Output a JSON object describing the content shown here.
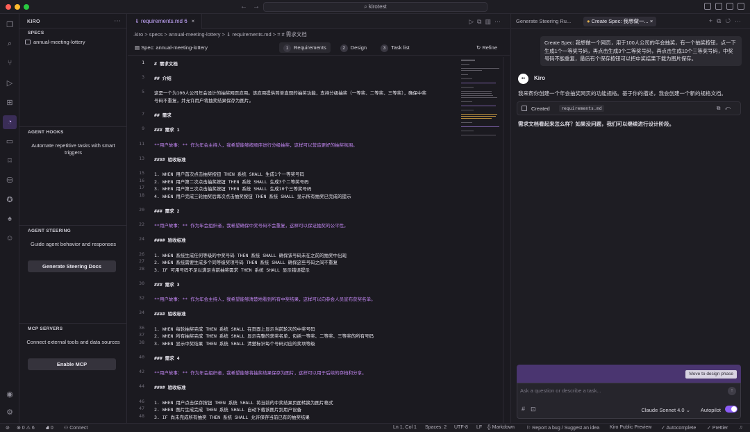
{
  "titlebar": {
    "search": "kirotest"
  },
  "sidebar": {
    "title": "KIRO",
    "specs_header": "SPECS",
    "spec_item": "annual-meeting-lottery",
    "hooks_header": "AGENT HOOKS",
    "hooks_text": "Automate repetitive tasks with smart triggers",
    "steering_header": "AGENT STEERING",
    "steering_text": "Guide agent behavior and responses",
    "steering_button": "Generate Steering Docs",
    "mcp_header": "MCP SERVERS",
    "mcp_text": "Connect external tools and data sources",
    "mcp_button": "Enable MCP"
  },
  "editor": {
    "tab_label": "requirements.md",
    "tab_badge": "6",
    "breadcrumb": ".kiro > specs > annual-meeting-lottery > ⇓ requirements.md > ⌗ # 需求文档",
    "spec_label": "Spec: annual-meeting-lottery",
    "steps": [
      {
        "n": "1",
        "label": "Requirements"
      },
      {
        "n": "2",
        "label": "Design"
      },
      {
        "n": "3",
        "label": "Task list"
      }
    ],
    "refine": "Refine",
    "lines": [
      {
        "n": "1",
        "t": "# 需求文档"
      },
      {
        "n": "",
        "t": ""
      },
      {
        "n": "3",
        "t": "## 介绍"
      },
      {
        "n": "",
        "t": ""
      },
      {
        "n": "5",
        "t": "这是一个为100人公司年会设计的抽奖网页应用。该应用提供简单直观的抽奖功能，支持分级抽奖（一等奖、二等奖、三等奖），确保中奖"
      },
      {
        "n": "",
        "t": "号码不重复，并允许用户将抽奖结果保存为图片。"
      },
      {
        "n": "",
        "t": ""
      },
      {
        "n": "7",
        "t": "## 需求"
      },
      {
        "n": "",
        "t": ""
      },
      {
        "n": "9",
        "t": "### 需求 1"
      },
      {
        "n": "",
        "t": ""
      },
      {
        "n": "11",
        "t": "**用户故事：** 作为年会主持人，我希望能够按顺序进行分级抽奖，这样可以营造更好的抽奖氛围。"
      },
      {
        "n": "",
        "t": ""
      },
      {
        "n": "13",
        "t": "#### 验收标准"
      },
      {
        "n": "",
        "t": ""
      },
      {
        "n": "15",
        "t": "1. WHEN 用户首次点击抽奖按钮 THEN 系统 SHALL 生成1个一等奖号码"
      },
      {
        "n": "16",
        "t": "2. WHEN 用户第二次点击抽奖按钮 THEN 系统 SHALL 生成3个二等奖号码"
      },
      {
        "n": "17",
        "t": "3. WHEN 用户第三次点击抽奖按钮 THEN 系统 SHALL 生成10个三等奖号码"
      },
      {
        "n": "18",
        "t": "4. WHEN 用户完成三轮抽奖后再次点击抽奖按钮 THEN 系统 SHALL 显示所有抽奖已完成的提示"
      },
      {
        "n": "",
        "t": ""
      },
      {
        "n": "20",
        "t": "### 需求 2"
      },
      {
        "n": "",
        "t": ""
      },
      {
        "n": "22",
        "t": "**用户故事：** 作为年会组织者，我希望确保中奖号码不会重复，这样可以保证抽奖的公平性。"
      },
      {
        "n": "",
        "t": ""
      },
      {
        "n": "24",
        "t": "#### 验收标准"
      },
      {
        "n": "",
        "t": ""
      },
      {
        "n": "26",
        "t": "1. WHEN 系统生成任何等级的中奖号码 THEN 系统 SHALL 确保该号码未在之前的抽奖中出现"
      },
      {
        "n": "27",
        "t": "2. WHEN 系统需要生成多个同等级奖项号码 THEN 系统 SHALL 确保这些号码之间不重复"
      },
      {
        "n": "28",
        "t": "3. IF 可用号码不足以满足当前抽奖需求 THEN 系统 SHALL 显示错误提示"
      },
      {
        "n": "",
        "t": ""
      },
      {
        "n": "30",
        "t": "### 需求 3"
      },
      {
        "n": "",
        "t": ""
      },
      {
        "n": "32",
        "t": "**用户故事：** 作为年会主持人，我希望能够清楚地看到所有中奖结果，这样可以向参会人员宣布获奖名单。"
      },
      {
        "n": "",
        "t": ""
      },
      {
        "n": "34",
        "t": "#### 验收标准"
      },
      {
        "n": "",
        "t": ""
      },
      {
        "n": "36",
        "t": "1. WHEN 每轮抽奖完成 THEN 系统 SHALL 在页面上显示当前轮次的中奖号码"
      },
      {
        "n": "37",
        "t": "2. WHEN 所有抽奖完成 THEN 系统 SHALL 显示完整的获奖名单，包括一等奖、二等奖、三等奖的所有号码"
      },
      {
        "n": "38",
        "t": "3. WHEN 显示中奖结果 THEN 系统 SHALL 清楚标识每个号码对应的奖项等级"
      },
      {
        "n": "",
        "t": ""
      },
      {
        "n": "40",
        "t": "### 需求 4"
      },
      {
        "n": "",
        "t": ""
      },
      {
        "n": "42",
        "t": "**用户故事：** 作为年会组织者，我希望能够将抽奖结果保存为图片，这样可以用于后续的存档和分享。"
      },
      {
        "n": "",
        "t": ""
      },
      {
        "n": "44",
        "t": "#### 验收标准"
      },
      {
        "n": "",
        "t": ""
      },
      {
        "n": "46",
        "t": "1. WHEN 用户点击保存按钮 THEN 系统 SHALL 将当前的中奖结果页面转换为图片格式"
      },
      {
        "n": "47",
        "t": "2. WHEN 图片生成完成 THEN 系统 SHALL 自动下载该图片到用户设备"
      },
      {
        "n": "48",
        "t": "3. IF 尚未完成所有抽奖 THEN 系统 SHALL 允许保存当前已有的抽奖结果"
      }
    ]
  },
  "chat": {
    "tab1": "Generate Steering Ru...",
    "tab2": "Create Spec: 我想做一...",
    "user_message": "Create Spec: 我想做一个网页，用于100人公司的年会抽奖，有一个抽奖按钮，点一下生成1个一等奖号码，再点击生成3个二等奖号码，再点击生成10个三等奖号码，中奖号码不能重复，最后有个保存按钮可以把中奖结果下载为图片保存。",
    "kiro_name": "Kiro",
    "kiro_msg1": "我来帮你创建一个年会抽奖网页的功能规格。基于你的描述，我会创建一个新的规格文档。",
    "created_label": "Created",
    "created_file": "requirements.md",
    "kiro_msg2": "需求文档看起来怎么样？如果没问题，我们可以继续进行设计阶段。",
    "phase_button": "Move to design phase",
    "input_placeholder": "Ask a question or describe a task...",
    "model": "Claude Sonnet 4.0",
    "autopilot": "Autopilot"
  },
  "status": {
    "errors": "⊗ 0 ⚠ 6",
    "ports": "⛘ 0",
    "connect": "Connect",
    "position": "Ln 1, Col 1",
    "spaces": "Spaces: 2",
    "encoding": "UTF-8",
    "eol": "LF",
    "language": "Markdown",
    "report": "Report a bug / Suggest an idea",
    "preview": "Kiro Public Preview",
    "autocomplete": "Autocomplete",
    "prettier": "Prettier"
  }
}
